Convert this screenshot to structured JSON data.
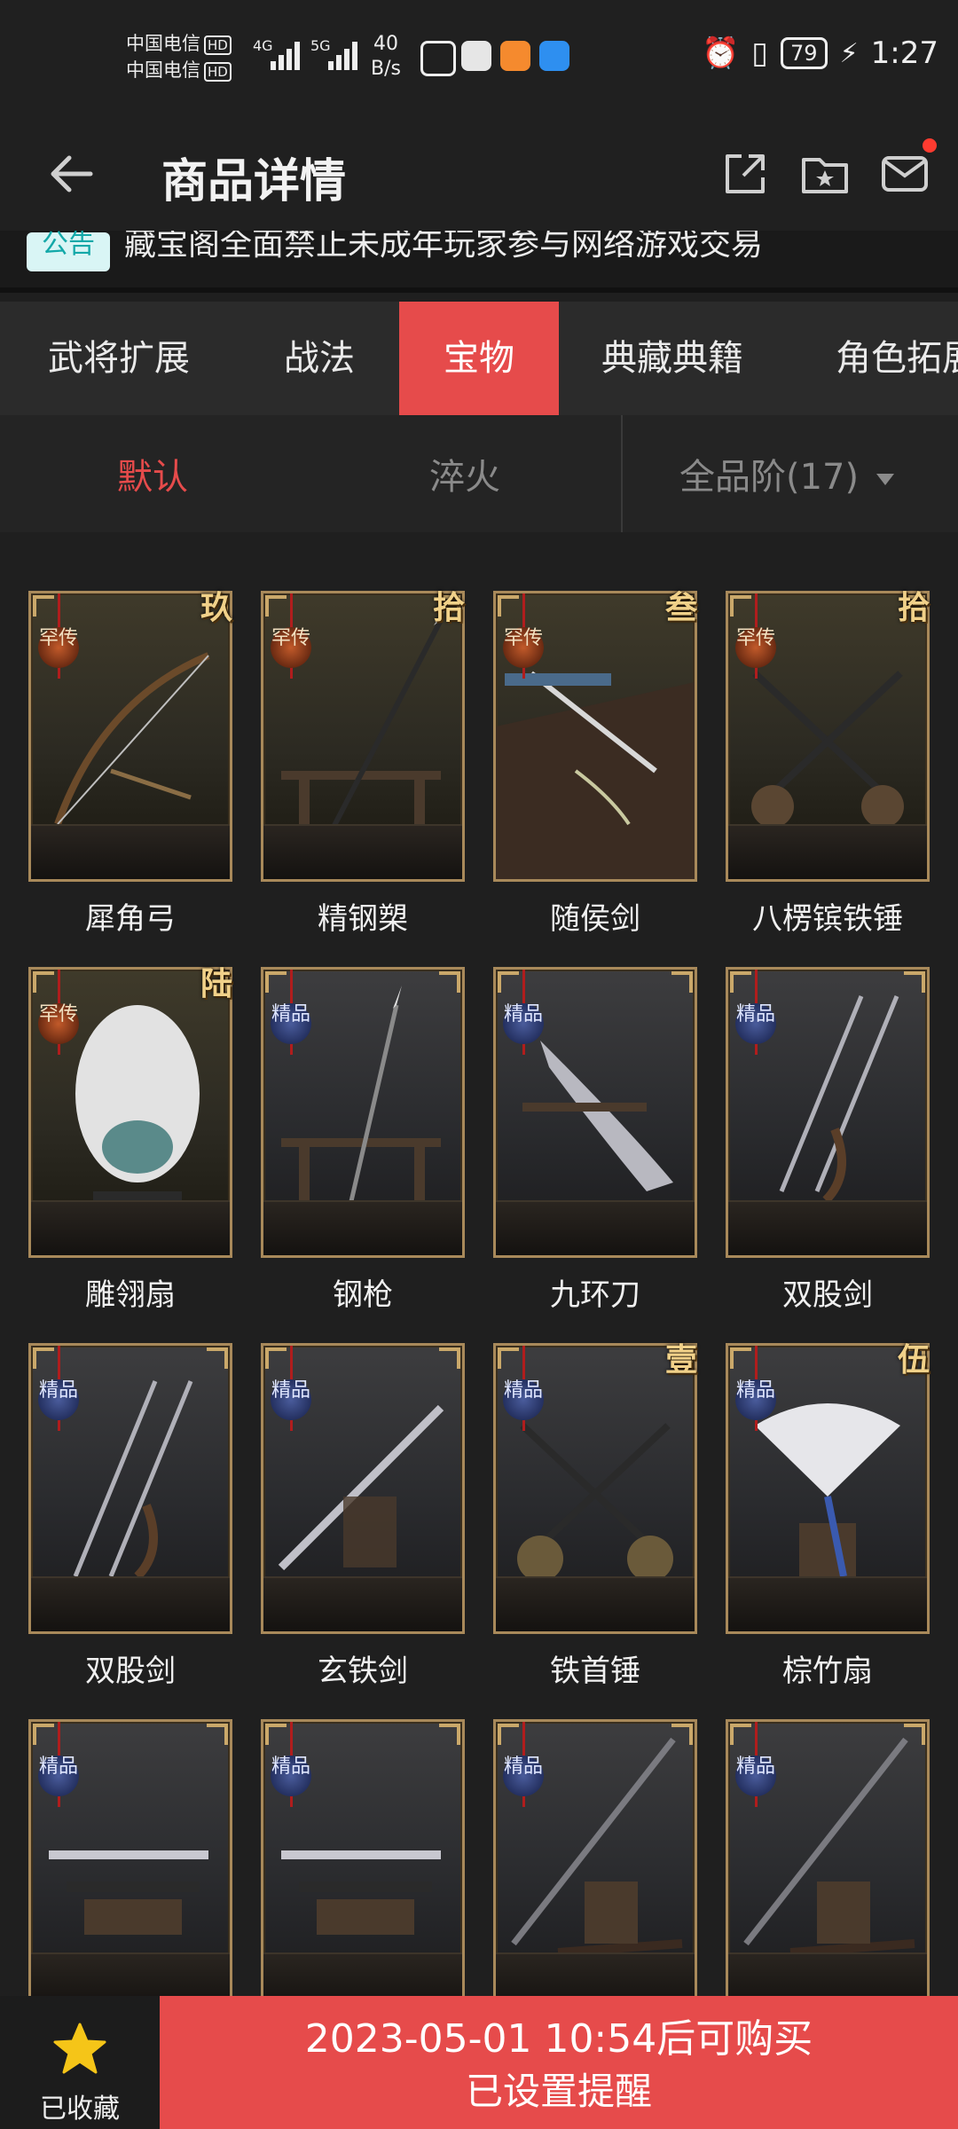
{
  "status_bar": {
    "carrier1": "中国电信",
    "carrier2": "中国电信",
    "hd": "HD",
    "net_4g": "4G",
    "net_5g": "5G",
    "speed_value": "40",
    "speed_unit": "B/s",
    "battery": "79",
    "time": "1:27"
  },
  "header": {
    "title": "商品详情"
  },
  "notice": {
    "tag": "公告",
    "text": "藏宝阁全面禁止未成年玩家参与网络游戏交易"
  },
  "category_tabs": [
    {
      "label": "武将扩展",
      "active": false
    },
    {
      "label": "战法",
      "active": false
    },
    {
      "label": "宝物",
      "active": true
    },
    {
      "label": "典藏典籍",
      "active": false
    },
    {
      "label": "角色拓展",
      "active": false
    }
  ],
  "sort_bar": {
    "default_label": "默认",
    "quench_label": "淬火",
    "grade_filter": "全品阶(17)"
  },
  "items": [
    {
      "name": "犀角弓",
      "rank": "罕传",
      "stars": "玖",
      "kind": "leg"
    },
    {
      "name": "精钢槊",
      "rank": "罕传",
      "stars": "拾",
      "kind": "leg"
    },
    {
      "name": "随侯剑",
      "rank": "罕传",
      "stars": "叁",
      "kind": "leg"
    },
    {
      "name": "八楞镔铁锤",
      "rank": "罕传",
      "stars": "拾",
      "kind": "leg"
    },
    {
      "name": "雕翎扇",
      "rank": "罕传",
      "stars": "陆",
      "kind": "leg"
    },
    {
      "name": "钢枪",
      "rank": "精品",
      "stars": "",
      "kind": "ref"
    },
    {
      "name": "九环刀",
      "rank": "精品",
      "stars": "",
      "kind": "ref"
    },
    {
      "name": "双股剑",
      "rank": "精品",
      "stars": "",
      "kind": "ref"
    },
    {
      "name": "双股剑",
      "rank": "精品",
      "stars": "",
      "kind": "ref"
    },
    {
      "name": "玄铁剑",
      "rank": "精品",
      "stars": "",
      "kind": "ref"
    },
    {
      "name": "铁首锤",
      "rank": "精品",
      "stars": "壹",
      "kind": "ref"
    },
    {
      "name": "棕竹扇",
      "rank": "精品",
      "stars": "伍",
      "kind": "ref"
    },
    {
      "name": "",
      "rank": "精品",
      "stars": "",
      "kind": "ref"
    },
    {
      "name": "",
      "rank": "精品",
      "stars": "",
      "kind": "ref"
    },
    {
      "name": "",
      "rank": "精品",
      "stars": "",
      "kind": "ref"
    },
    {
      "name": "",
      "rank": "精品",
      "stars": "",
      "kind": "ref"
    }
  ],
  "bottom_bar": {
    "favorite_label": "已收藏",
    "buy_line1": "2023-05-01 10:54后可购买",
    "buy_line2": "已设置提醒"
  },
  "colors": {
    "accent": "#e64b4b",
    "background": "#1f1f1f",
    "gold": "#f1d189",
    "favorite_star": "#f5c518"
  }
}
